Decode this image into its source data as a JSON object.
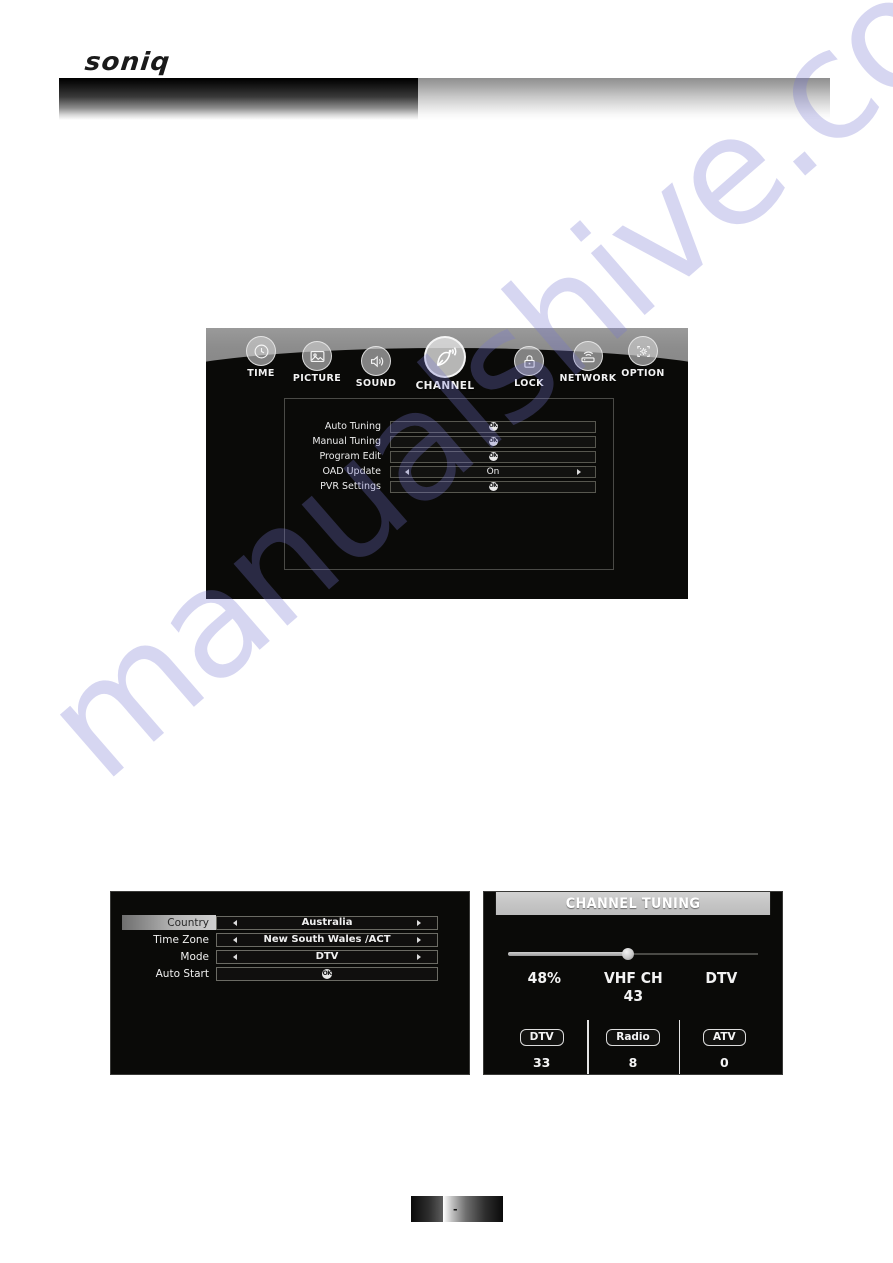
{
  "header": {
    "brand": "soniq"
  },
  "watermark": {
    "text": "manualshive.com"
  },
  "main_menu": {
    "items": [
      {
        "label": "TIME",
        "icon": "clock-icon",
        "selected": false
      },
      {
        "label": "PICTURE",
        "icon": "picture-icon",
        "selected": false
      },
      {
        "label": "SOUND",
        "icon": "speaker-icon",
        "selected": false
      },
      {
        "label": "CHANNEL",
        "icon": "satellite-dish-icon",
        "selected": true
      },
      {
        "label": "LOCK",
        "icon": "padlock-icon",
        "selected": false
      },
      {
        "label": "NETWORK",
        "icon": "wifi-router-icon",
        "selected": false
      },
      {
        "label": "OPTION",
        "icon": "settings-icon",
        "selected": false
      }
    ],
    "options": [
      {
        "label": "Auto Tuning",
        "control": "ok",
        "value": "OK"
      },
      {
        "label": "Manual Tuning",
        "control": "ok",
        "value": "OK"
      },
      {
        "label": "Program Edit",
        "control": "ok",
        "value": "OK"
      },
      {
        "label": "OAD Update",
        "control": "spinner",
        "value": "On"
      },
      {
        "label": "PVR Settings",
        "control": "ok",
        "value": "OK"
      }
    ]
  },
  "setup_menu": {
    "rows": [
      {
        "label": "Country",
        "control": "spinner",
        "value": "Australia",
        "highlighted": true
      },
      {
        "label": "Time Zone",
        "control": "spinner",
        "value": "New South Wales /ACT",
        "highlighted": false
      },
      {
        "label": "Mode",
        "control": "spinner",
        "value": "DTV",
        "highlighted": false
      },
      {
        "label": "Auto Start",
        "control": "ok",
        "value": "OK",
        "highlighted": false
      }
    ]
  },
  "channel_tuning": {
    "title": "CHANNEL TUNING",
    "progress_percent": 48,
    "progress_labels": {
      "percent": "48%",
      "channel": "VHF CH 43",
      "mode": "DTV"
    },
    "counters": [
      {
        "label": "DTV",
        "value": "33"
      },
      {
        "label": "Radio",
        "value": "8"
      },
      {
        "label": "ATV",
        "value": "0"
      }
    ]
  },
  "footer": {
    "left_dash": "-",
    "right_dash": "-"
  },
  "colors": {
    "osd_background": "#0a0a08",
    "osd_strip": "#8d8d8d",
    "title_bar": "#c6c6c6",
    "highlight": "#b4b4b4",
    "text": "#f0f0f0",
    "watermark": "#7878d2"
  }
}
